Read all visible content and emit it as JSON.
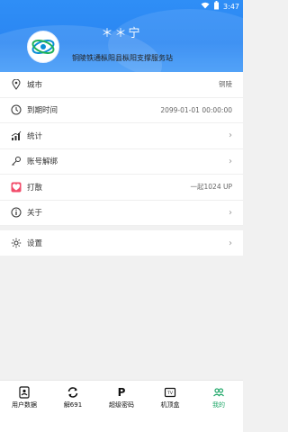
{
  "status": {
    "time": "3:47"
  },
  "user": {
    "name": "＊＊宁",
    "station": "铜陵铁通枞阳县枞阳支撑服务站"
  },
  "list": {
    "city": {
      "label": "城市",
      "value": "铜陵"
    },
    "expiry": {
      "label": "到期时间",
      "value": "2099-01-01 00:00:00"
    },
    "stats": {
      "label": "统计"
    },
    "unbind": {
      "label": "账号解绑"
    },
    "tip": {
      "label": "打散",
      "value": "一起1024 UP"
    },
    "about": {
      "label": "关于"
    },
    "settings": {
      "label": "设置"
    }
  },
  "tabs": [
    {
      "label": "用户数据"
    },
    {
      "label": "解691"
    },
    {
      "label": "超级密码"
    },
    {
      "label": "机顶盒"
    },
    {
      "label": "我的"
    }
  ],
  "colors": {
    "primary": "#2a86f2",
    "active": "#21a86a"
  }
}
